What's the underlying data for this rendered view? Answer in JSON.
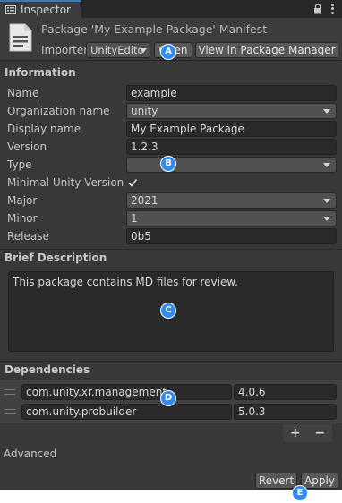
{
  "tab": {
    "label": "Inspector",
    "icon": "info-icon"
  },
  "header": {
    "title": "Package 'My Example Package' Manifest",
    "importer_label": "Importer",
    "importer_value": "UnityEdito",
    "open_label": "Open",
    "view_pm_label": "View in Package Manager"
  },
  "information": {
    "heading": "Information",
    "rows": [
      {
        "label": "Name",
        "value": "example"
      },
      {
        "label": "Organization name",
        "value": "unity"
      },
      {
        "label": "Display name",
        "value": "My Example Package"
      },
      {
        "label": "Version",
        "value": "1.2.3"
      },
      {
        "label": "Type",
        "value": ""
      },
      {
        "label": "Minimal Unity Version",
        "checked": true
      },
      {
        "label": "Major",
        "value": "2021"
      },
      {
        "label": "Minor",
        "value": "1"
      },
      {
        "label": "Release",
        "value": "0b5"
      }
    ]
  },
  "description": {
    "heading": "Brief Description",
    "text": "This package contains MD files for review."
  },
  "dependencies": {
    "heading": "Dependencies",
    "items": [
      {
        "name": "com.unity.xr.management",
        "version": "4.0.6"
      },
      {
        "name": "com.unity.probuilder",
        "version": "5.0.3"
      }
    ],
    "add_label": "+",
    "remove_label": "−"
  },
  "advanced_label": "Advanced",
  "footer": {
    "revert_label": "Revert",
    "apply_label": "Apply"
  },
  "markers": [
    "A",
    "B",
    "C",
    "D",
    "E"
  ],
  "colors": {
    "accent": "#2f8cf0",
    "panel_bg": "#383838",
    "tab_highlight": "#3a79bb"
  }
}
